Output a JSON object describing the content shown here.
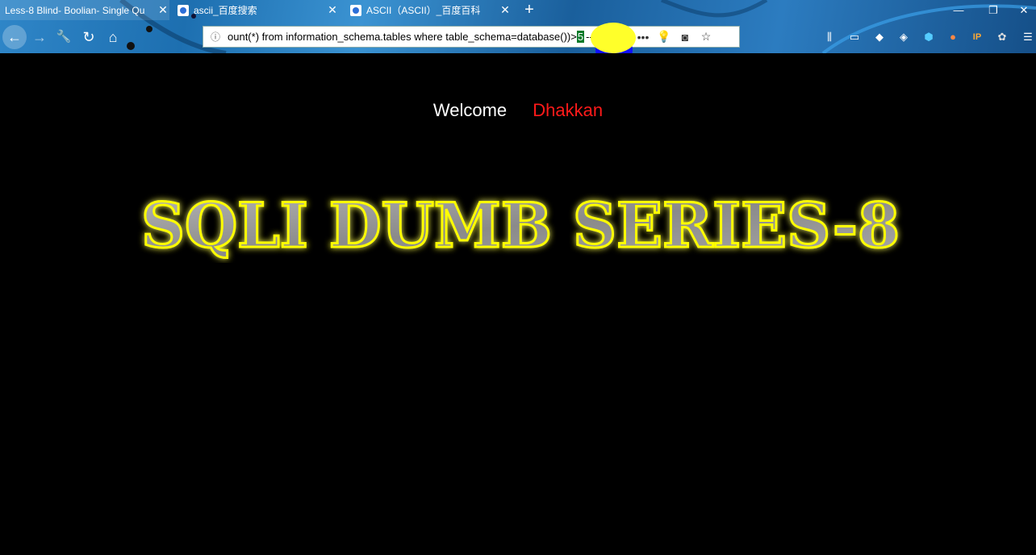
{
  "tabs": [
    {
      "title": "Less-8 Blind- Boolian- Single Qu",
      "active": true
    },
    {
      "title": "ascii_百度搜索",
      "active": false
    },
    {
      "title": "ASCII（ASCII）_百度百科",
      "active": false
    }
  ],
  "toolbar": {
    "url_text": "ount(*) from information_schema.tables where table_schema=database())>",
    "url_selected": "5",
    "url_tail": "--+"
  },
  "page": {
    "welcome_label": "Welcome",
    "welcome_name": "Dhakkan",
    "banner_text": "SQLI DUMB SERIES-8"
  },
  "colors": {
    "page_bg": "#000000",
    "welcome_name": "#ff1a1a",
    "banner_glow": "#ffff00",
    "banner_fill": "#9a9a9a"
  }
}
